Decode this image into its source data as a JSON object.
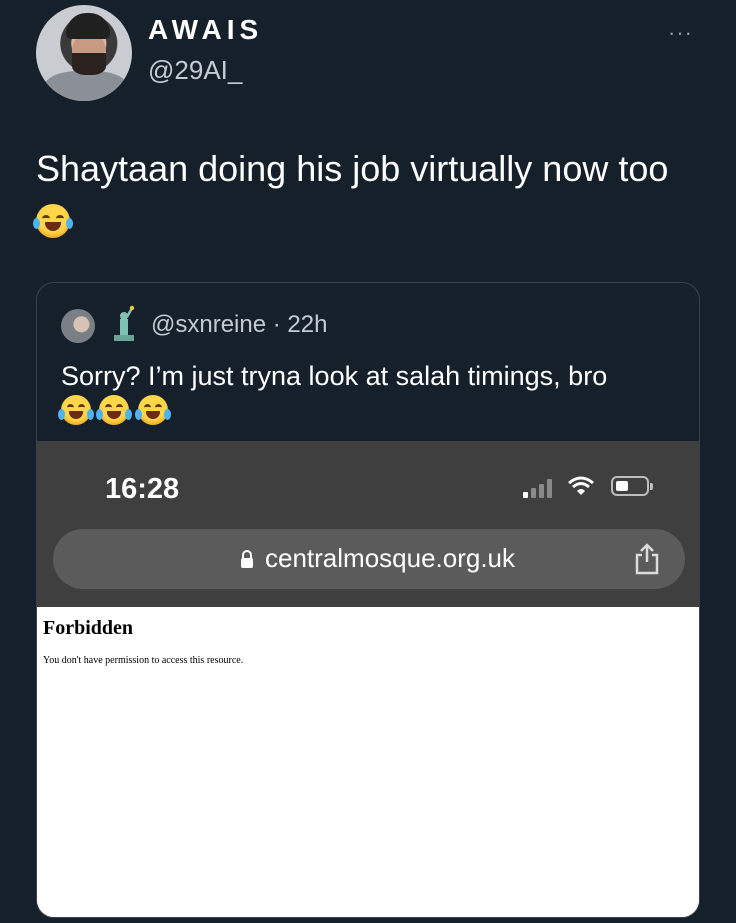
{
  "tweet": {
    "display_name": "AWAIS",
    "handle": "@29AI_",
    "more_label": "···",
    "text": "Shaytaan doing his job virtually now too"
  },
  "quoted": {
    "handle": "@sxnreine",
    "time": "· 22h",
    "text": "Sorry? I’m just tryna look at salah timings, bro",
    "emoji_count": 3,
    "flag_icon": "statue-of-liberty-icon"
  },
  "screenshot": {
    "status_time": "16:28",
    "url": "centralmosque.org.uk",
    "page_title": "Forbidden",
    "page_message": "You don't have permission to access this resource."
  },
  "colors": {
    "background": "#15202b",
    "border": "#38444d",
    "browser_chrome": "#3f3f3f",
    "url_bar": "#5b5b5b"
  }
}
